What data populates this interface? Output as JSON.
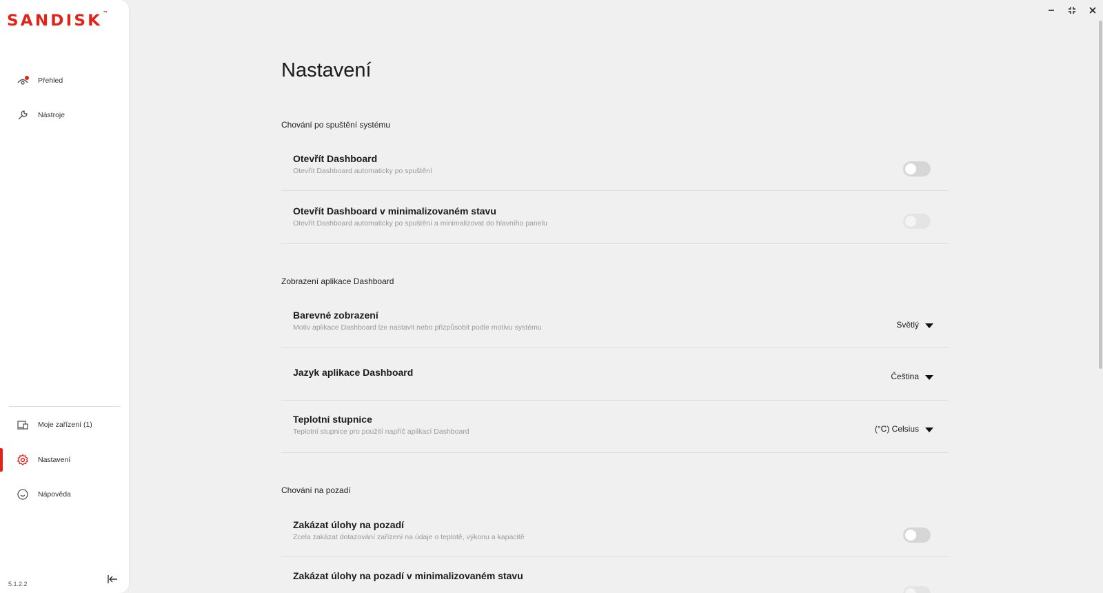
{
  "brand": {
    "logo_text": "SANDISK",
    "trademark": "™",
    "accent_color": "#e2231a"
  },
  "sidebar": {
    "top_items": [
      {
        "label": "Přehled",
        "icon": "overview-icon",
        "has_notification_dot": true
      },
      {
        "label": "Nástroje",
        "icon": "tools-icon"
      }
    ],
    "bottom_items": [
      {
        "label": "Moje zařízení (1)",
        "icon": "devices-icon"
      },
      {
        "label": "Nastavení",
        "icon": "gear-icon",
        "active": true
      },
      {
        "label": "Nápověda",
        "icon": "help-icon"
      }
    ],
    "version": "5.1.2.2",
    "collapse_icon": "collapse-left-icon"
  },
  "window_controls": [
    "minimize-icon",
    "restore-icon",
    "close-icon"
  ],
  "main": {
    "title": "Nastavení",
    "sections": [
      {
        "heading": "Chování po spuštění systému",
        "rows": [
          {
            "title": "Otevřít Dashboard",
            "description": "Otevřít Dashboard automaticky po spuštění",
            "control": "toggle",
            "on": false,
            "disabled": false
          },
          {
            "title": "Otevřít Dashboard v minimalizovaném stavu",
            "description": "Otevřít Dashboard automaticky po spuštění a minimalizovat do hlavního panelu",
            "control": "toggle",
            "on": false,
            "disabled": true
          }
        ]
      },
      {
        "heading": "Zobrazení aplikace Dashboard",
        "rows": [
          {
            "title": "Barevné zobrazení",
            "description": "Motiv aplikace Dashboard lze nastavit nebo přizpůsobit podle motivu systému",
            "control": "select",
            "value": "Světlý"
          },
          {
            "title": "Jazyk aplikace Dashboard",
            "description": "",
            "control": "select",
            "value": "Čeština"
          },
          {
            "title": "Teplotní stupnice",
            "description": "Teplotní stupnice pro použití napříč aplikací Dashboard",
            "control": "select",
            "value": "(°C) Celsius"
          }
        ]
      },
      {
        "heading": "Chování na pozadí",
        "rows": [
          {
            "title": "Zakázat úlohy na pozadí",
            "description": "Zcela zakázat dotazování zařízení na údaje o teplotě, výkonu a kapacitě",
            "control": "toggle",
            "on": false,
            "disabled": false
          },
          {
            "title": "Zakázat úlohy na pozadí v minimalizovaném stavu",
            "description": "",
            "control": "toggle",
            "on": false,
            "disabled": true
          }
        ]
      }
    ]
  }
}
